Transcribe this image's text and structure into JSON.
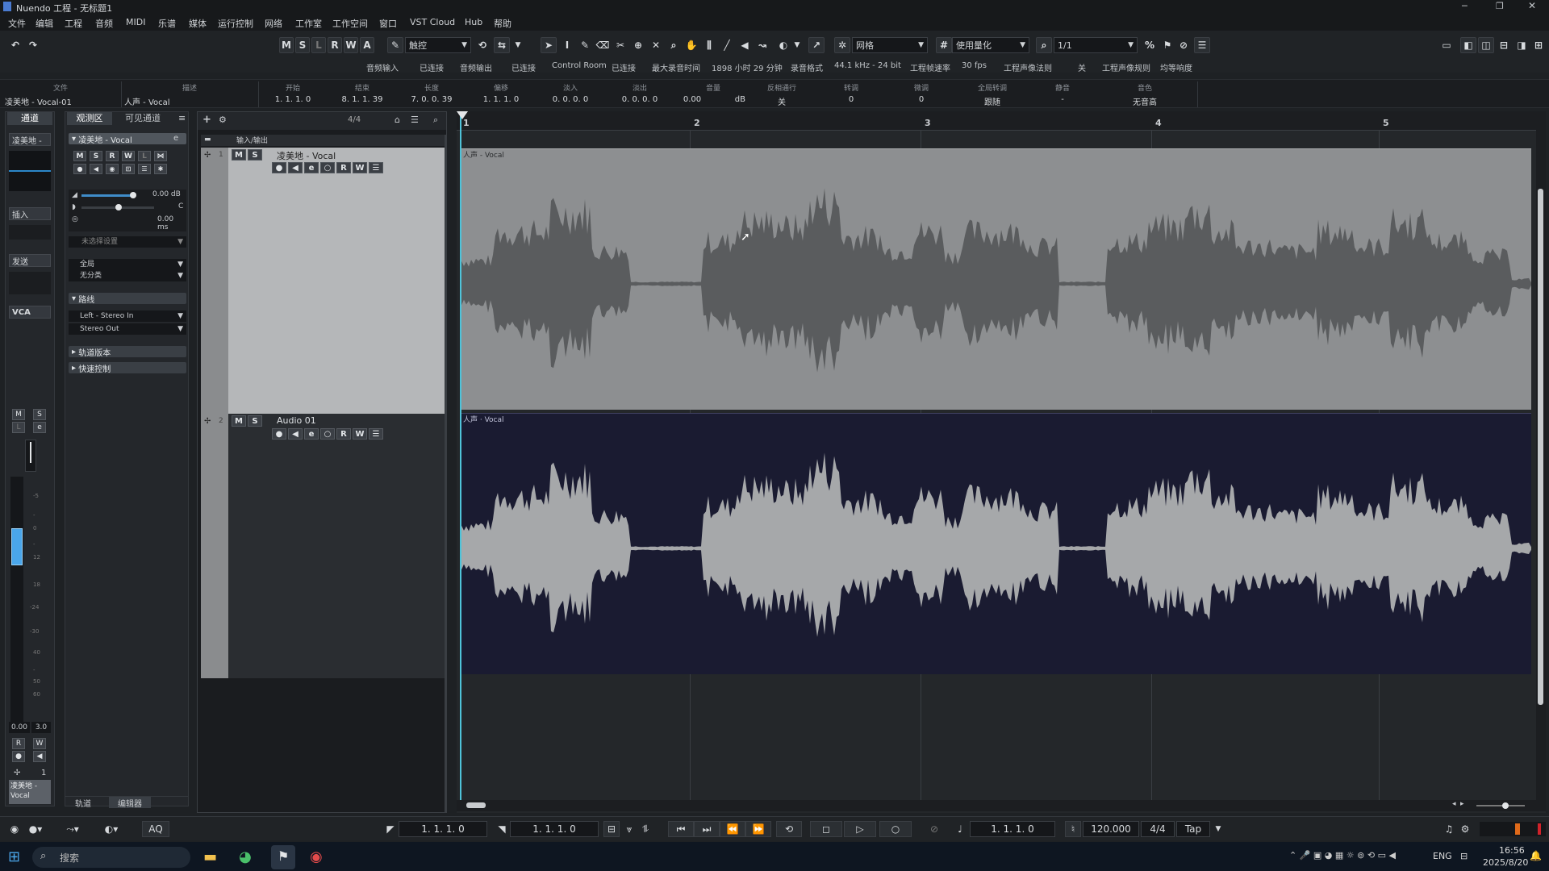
{
  "window": {
    "title": "Nuendo 工程 - 无标题1"
  },
  "menu": [
    "文件",
    "编辑",
    "工程",
    "音频",
    "MIDI",
    "乐谱",
    "媒体",
    "运行控制",
    "网络",
    "工作室",
    "工作空间",
    "窗口",
    "VST Cloud",
    "Hub",
    "帮助"
  ],
  "toolbar": {
    "mode_buttons": [
      "M",
      "S",
      "L",
      "R",
      "W",
      "A"
    ],
    "automation_mode": "触控",
    "snap_type": "网格",
    "quantize_type": "使用量化",
    "quantize_value": "1/1"
  },
  "statusline": {
    "items": [
      "音频输入",
      "已连接",
      "音频输出",
      "已连接",
      "Control Room",
      "已连接",
      "最大录音时间",
      "1898 小时 29 分钟",
      "录音格式",
      "44.1 kHz - 24 bit",
      "工程帧速率",
      "30 fps",
      "工程声像法则",
      "关",
      "工程声像规则",
      "均等响度"
    ]
  },
  "infoline": {
    "headers": [
      "文件",
      "描述",
      "开始",
      "结束",
      "长度",
      "偏移",
      "淡入",
      "淡出",
      "音量",
      "反相通行",
      "转调",
      "微调",
      "全局转调",
      "静音",
      "音色"
    ],
    "values": [
      "凌美地 - Vocal-01",
      "人声 - Vocal",
      "1. 1. 1. 0",
      "8. 1. 1. 39",
      "7. 0. 0. 39",
      "1. 1. 1. 0",
      "0. 0. 0. 0",
      "0. 0. 0. 0",
      "0.00",
      "dB",
      "关",
      "0",
      "0",
      "跟随",
      "-",
      "无音高"
    ]
  },
  "inspector_left": {
    "tab": "通道",
    "track_name": "凌美地 - ",
    "insert_label": "插入",
    "send_label": "发送",
    "vca_label": "VCA",
    "fader_value": "0.00",
    "pan_value": "3.0",
    "channel_number": "1",
    "channel_name": "凌美地 - Vocal",
    "scale": [
      "-5",
      "-",
      "0",
      "-",
      "12",
      "18",
      "-24",
      "-30",
      "40",
      "-",
      "50",
      "60"
    ]
  },
  "inspector": {
    "tab_active": "观测区",
    "tab_other": "可见通道",
    "track_header": "凌美地 - Vocal",
    "volume": "0.00 dB",
    "pan": "C",
    "delay": "0.00 ms",
    "input_routing_hint": "未选择设置",
    "eq_label": "全局",
    "input_label": "无分类",
    "routing_section": "路线",
    "input": "Left - Stereo In",
    "output": "Stereo Out",
    "section_version": "轨道版本",
    "section_quick": "快速控制",
    "bottom_tab1": "轨道",
    "bottom_tab2": "编辑器"
  },
  "tracklist": {
    "counter": "4/4",
    "folder_label": "输入/输出",
    "tracks": [
      {
        "number": "1",
        "name": "凌美地 - Vocal"
      },
      {
        "number": "2",
        "name": "Audio 01"
      }
    ]
  },
  "ruler": {
    "bars": [
      "1",
      "2",
      "3",
      "4",
      "5"
    ]
  },
  "events": [
    {
      "label": "人声 - Vocal"
    },
    {
      "label": "人声 · Vocal"
    }
  ],
  "transport": {
    "left_locator": "1. 1. 1. 0",
    "right_locator": "1. 1. 1. 0",
    "position": "1. 1. 1. 0",
    "tempo": "120.000",
    "signature": "4/4",
    "tap": "Tap",
    "aq": "AQ"
  },
  "taskbar": {
    "search_placeholder": "搜索",
    "language": "ENG",
    "time": "16:56",
    "date": "2025/8/20"
  },
  "colors": {
    "event_top": "#8d8f91",
    "event_bottom": "#1a1b31",
    "wave_top": "#5a5c5e",
    "wave_bottom": "#a6a8aa",
    "cursor": "#4fc3d9"
  }
}
